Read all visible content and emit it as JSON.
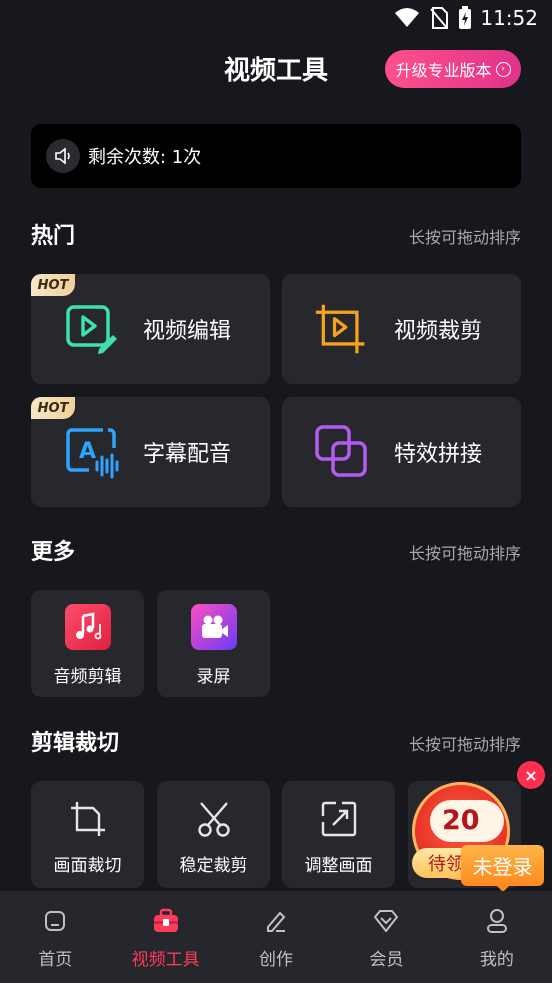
{
  "status_bar": {
    "time": "11:52",
    "icons": [
      "wifi-icon",
      "no-sim-icon",
      "battery-charging-icon"
    ]
  },
  "header": {
    "title": "视频工具",
    "upgrade_label": "升级专业版本"
  },
  "remaining": {
    "text": "剩余次数: 1次"
  },
  "sections": {
    "hot": {
      "title": "热门",
      "hint": "长按可拖动排序"
    },
    "more": {
      "title": "更多",
      "hint": "长按可拖动排序"
    },
    "cut": {
      "title": "剪辑裁切",
      "hint": "长按可拖动排序"
    }
  },
  "hot_items": [
    {
      "label": "视频编辑",
      "badge": "HOT",
      "icon": "video-edit-icon"
    },
    {
      "label": "视频裁剪",
      "icon": "video-crop-icon"
    },
    {
      "label": "字幕配音",
      "badge": "HOT",
      "icon": "subtitle-voice-icon"
    },
    {
      "label": "特效拼接",
      "icon": "effect-merge-icon"
    }
  ],
  "more_items": [
    {
      "label": "音频剪辑",
      "icon": "music-icon"
    },
    {
      "label": "录屏",
      "icon": "screen-record-icon"
    }
  ],
  "cut_items": [
    {
      "label": "画面裁切",
      "icon": "crop-icon"
    },
    {
      "label": "稳定裁剪",
      "icon": "scissors-icon"
    },
    {
      "label": "调整画面",
      "icon": "resize-icon"
    }
  ],
  "promo": {
    "amount": "20",
    "pill": "待领",
    "login_label": "未登录"
  },
  "nav": [
    {
      "label": "首页",
      "icon": "home-icon"
    },
    {
      "label": "视频工具",
      "icon": "toolbox-icon",
      "active": true
    },
    {
      "label": "创作",
      "icon": "pen-icon"
    },
    {
      "label": "会员",
      "icon": "diamond-icon"
    },
    {
      "label": "我的",
      "icon": "user-icon"
    }
  ],
  "colors": {
    "background": "#17181d",
    "card": "#27282e",
    "accent": "#ff3b5c"
  }
}
